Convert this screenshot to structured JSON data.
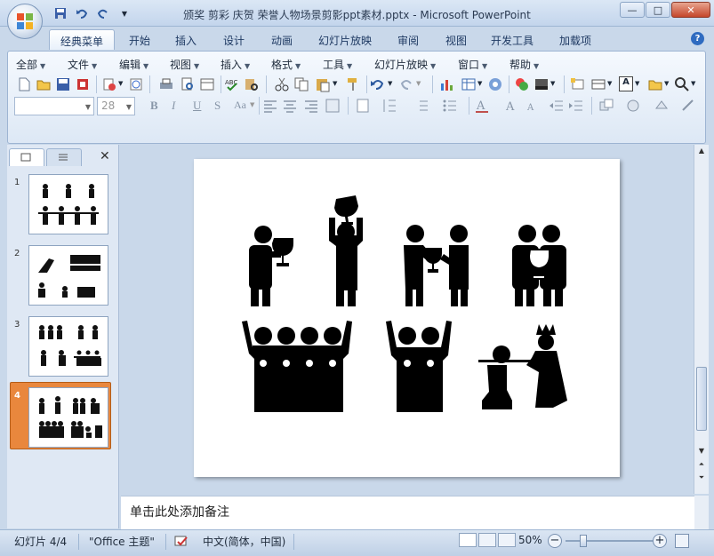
{
  "window": {
    "title": "颁奖 剪彩 庆贺 荣誉人物场景剪影ppt素材.pptx - Microsoft PowerPoint",
    "minimize_label": "—",
    "maximize_label": "□",
    "close_label": "✕"
  },
  "ribbon_tabs": [
    "经典菜单",
    "开始",
    "插入",
    "设计",
    "动画",
    "幻灯片放映",
    "审阅",
    "视图",
    "开发工具",
    "加载项"
  ],
  "active_tab": "经典菜单",
  "help_label": "?",
  "classic_menu": [
    "全部",
    "文件",
    "编辑",
    "视图",
    "插入",
    "格式",
    "工具",
    "幻灯片放映",
    "窗口",
    "帮助"
  ],
  "font": {
    "name": "",
    "size": "28"
  },
  "format_buttons": {
    "bold": "B",
    "italic": "I",
    "underline": "U",
    "strike": "S",
    "shadow": "Aa",
    "text_box": "A"
  },
  "thumbnails": [
    {
      "number": "1"
    },
    {
      "number": "2"
    },
    {
      "number": "3"
    },
    {
      "number": "4"
    }
  ],
  "selected_slide": 4,
  "notes_placeholder": "单击此处添加备注",
  "status": {
    "slide_counter": "幻灯片 4/4",
    "theme": "\"Office 主题\"",
    "language": "中文(简体，中国)",
    "zoom": "50%"
  },
  "colors": {
    "accent_selected_thumb": "#e9873d",
    "ribbon_bg": "#dde8f5",
    "frame": "#c9d8ea"
  }
}
